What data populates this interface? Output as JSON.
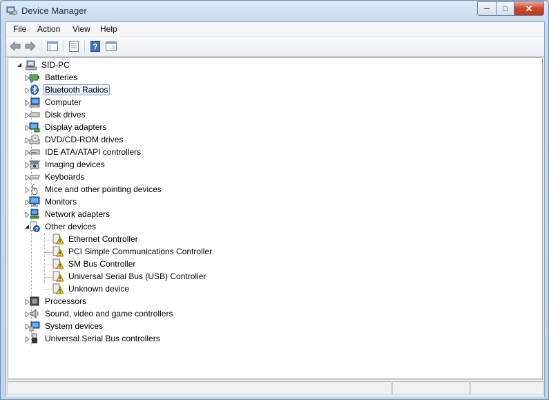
{
  "window": {
    "title": "Device Manager"
  },
  "menu": [
    {
      "name": "menu-file",
      "label": "File"
    },
    {
      "name": "menu-action",
      "label": "Action"
    },
    {
      "name": "menu-view",
      "label": "View"
    },
    {
      "name": "menu-help",
      "label": "Help"
    }
  ],
  "toolbar": [
    {
      "name": "back-button",
      "icon": "back-arrow-icon"
    },
    {
      "name": "forward-button",
      "icon": "forward-arrow-icon"
    },
    {
      "name": "show-hide-console-tree-button",
      "icon": "console-tree-icon"
    },
    {
      "name": "properties-button",
      "icon": "properties-icon"
    },
    {
      "name": "help-button",
      "icon": "help-icon"
    },
    {
      "name": "show-action-pane-button",
      "icon": "action-pane-icon"
    }
  ],
  "tree": {
    "root": {
      "label": "SID-PC",
      "icon": "computer-root-icon",
      "expanded": true
    },
    "categories": [
      {
        "label": "Batteries",
        "icon": "battery-icon",
        "expanded": false
      },
      {
        "label": "Bluetooth Radios",
        "icon": "bluetooth-icon",
        "expanded": false,
        "selected": true
      },
      {
        "label": "Computer",
        "icon": "computer-icon",
        "expanded": false
      },
      {
        "label": "Disk drives",
        "icon": "disk-drive-icon",
        "expanded": false
      },
      {
        "label": "Display adapters",
        "icon": "display-adapter-icon",
        "expanded": false
      },
      {
        "label": "DVD/CD-ROM drives",
        "icon": "dvd-drive-icon",
        "expanded": false
      },
      {
        "label": "IDE ATA/ATAPI controllers",
        "icon": "ide-controller-icon",
        "expanded": false
      },
      {
        "label": "Imaging devices",
        "icon": "imaging-device-icon",
        "expanded": false
      },
      {
        "label": "Keyboards",
        "icon": "keyboard-icon",
        "expanded": false
      },
      {
        "label": "Mice and other pointing devices",
        "icon": "mouse-icon",
        "expanded": false
      },
      {
        "label": "Monitors",
        "icon": "monitor-icon",
        "expanded": false
      },
      {
        "label": "Network adapters",
        "icon": "network-adapter-icon",
        "expanded": false
      },
      {
        "label": "Other devices",
        "icon": "other-devices-icon",
        "expanded": true,
        "children": [
          {
            "label": "Ethernet Controller",
            "icon": "unknown-device-warning-icon"
          },
          {
            "label": "PCI Simple Communications Controller",
            "icon": "unknown-device-warning-icon"
          },
          {
            "label": "SM Bus Controller",
            "icon": "unknown-device-warning-icon"
          },
          {
            "label": "Universal Serial Bus (USB) Controller",
            "icon": "unknown-device-warning-icon"
          },
          {
            "label": "Unknown device",
            "icon": "unknown-device-warning-icon"
          }
        ]
      },
      {
        "label": "Processors",
        "icon": "processor-icon",
        "expanded": false
      },
      {
        "label": "Sound, video and game controllers",
        "icon": "speaker-icon",
        "expanded": false
      },
      {
        "label": "System devices",
        "icon": "system-devices-icon",
        "expanded": false
      },
      {
        "label": "Universal Serial Bus controllers",
        "icon": "usb-icon",
        "expanded": false
      }
    ]
  },
  "colors": {
    "selection_border": "#7da2ce",
    "selection_fill": "#dceafb",
    "warning_yellow": "#f7d33a",
    "close_red": "#c8452c"
  }
}
